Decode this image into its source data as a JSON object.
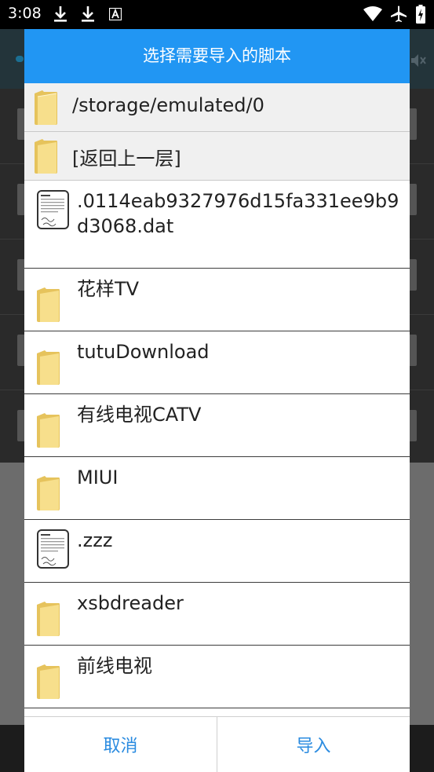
{
  "status_bar": {
    "time": "3:08",
    "icons": [
      "download-icon",
      "download-icon",
      "text-a-icon",
      "wifi-icon",
      "airplane-icon",
      "battery-charging-icon"
    ]
  },
  "dialog": {
    "title": "选择需要导入的脚本",
    "current_path": "/storage/emulated/0",
    "go_up_label": "[返回上一层]",
    "items": [
      {
        "name": ".0114eab9327976d15fa331ee9b9d3068.dat",
        "type": "file"
      },
      {
        "name": "花样TV",
        "type": "folder"
      },
      {
        "name": "tutuDownload",
        "type": "folder"
      },
      {
        "name": "有线电视CATV",
        "type": "folder"
      },
      {
        "name": "MIUI",
        "type": "folder"
      },
      {
        "name": ".zzz",
        "type": "file"
      },
      {
        "name": "xsbdreader",
        "type": "folder"
      },
      {
        "name": "前线电视",
        "type": "folder"
      }
    ],
    "cancel_label": "取消",
    "import_label": "导入"
  },
  "colors": {
    "title_bar": "#2196f3",
    "button_text": "#2a8be0",
    "folder": "#f3d77a"
  }
}
